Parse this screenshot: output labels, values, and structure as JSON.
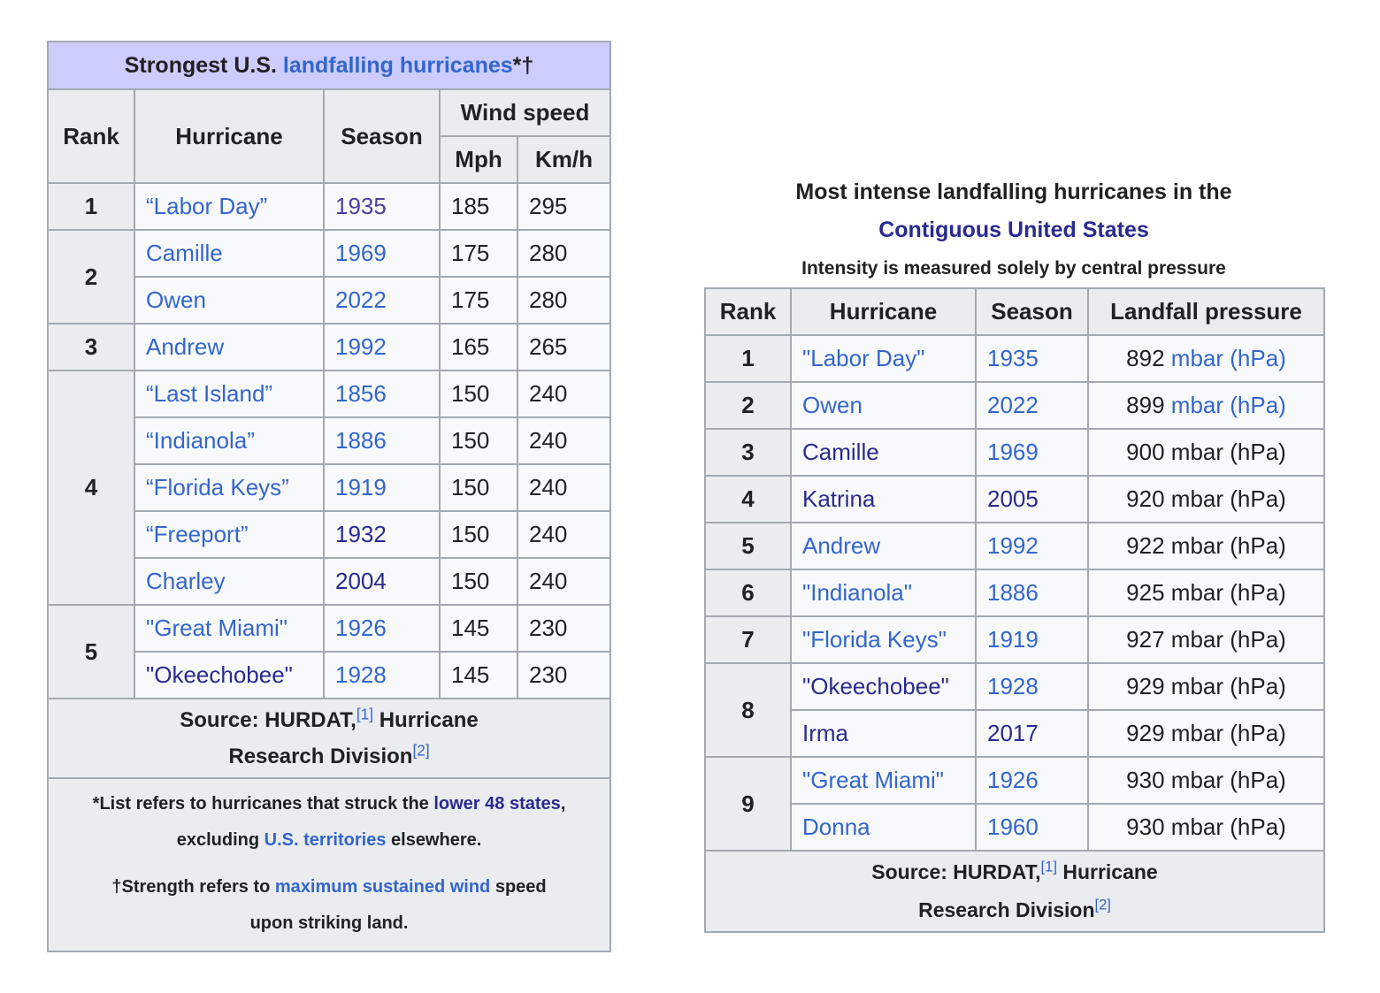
{
  "table1": {
    "caption": {
      "prefix": "Strongest U.S. ",
      "link": "landfalling hurricanes",
      "suffix": "*†"
    },
    "headers": {
      "rank": "Rank",
      "hurricane": "Hurricane",
      "season": "Season",
      "wind_speed": "Wind speed",
      "mph": "Mph",
      "kmh": "Km/h"
    },
    "rows": [
      {
        "rank": "1",
        "name": "“Labor Day”",
        "season": "1935",
        "mph": "185",
        "kmh": "295"
      },
      {
        "rank": "2",
        "name": "Camille",
        "season": "1969",
        "mph": "175",
        "kmh": "280"
      },
      {
        "name": "Owen",
        "season": "2022",
        "mph": "175",
        "kmh": "280"
      },
      {
        "rank": "3",
        "name": "Andrew",
        "season": "1992",
        "mph": "165",
        "kmh": "265"
      },
      {
        "rank": "4",
        "name": "“Last Island”",
        "season": "1856",
        "mph": "150",
        "kmh": "240"
      },
      {
        "name": "“Indianola”",
        "season": "1886",
        "mph": "150",
        "kmh": "240"
      },
      {
        "name": "“Florida Keys”",
        "season": "1919",
        "mph": "150",
        "kmh": "240"
      },
      {
        "name": "“Freeport”",
        "season": "1932",
        "mph": "150",
        "kmh": "240"
      },
      {
        "name": "Charley",
        "season": "2004",
        "mph": "150",
        "kmh": "240"
      },
      {
        "rank": "5",
        "name": "\"Great Miami\"",
        "season": "1926",
        "mph": "145",
        "kmh": "230"
      },
      {
        "name": "\"Okeechobee\"",
        "season": "1928",
        "mph": "145",
        "kmh": "230"
      }
    ],
    "source": {
      "text1": "Source: HURDAT,",
      "ref1": "[1]",
      "text2": " Hurricane",
      "text3": "Research Division",
      "ref2": "[2]"
    },
    "notes": {
      "n1_a": "*List refers to hurricanes that struck the ",
      "n1_link1": "lower 48 states",
      "n1_b": ",",
      "n1_c": "excluding ",
      "n1_link2": "U.S. territories",
      "n1_d": " elsewhere.",
      "n2_a": "†Strength refers to ",
      "n2_link": "maximum sustained wind",
      "n2_b": " speed",
      "n2_c": "upon striking land."
    }
  },
  "table2": {
    "caption_line1": "Most intense landfalling hurricanes in the",
    "caption_link": "Contiguous United States",
    "subtitle": "Intensity is measured solely by central pressure",
    "headers": {
      "rank": "Rank",
      "hurricane": "Hurricane",
      "season": "Season",
      "pressure": "Landfall pressure"
    },
    "rows": [
      {
        "rank": "1",
        "name": "\"Labor Day\"",
        "season": "1935",
        "value": "892",
        "unit": "mbar",
        "unit2": "(hPa)"
      },
      {
        "rank": "2",
        "name": "Owen",
        "season": "2022",
        "value": "899",
        "unit": "mbar",
        "unit2": "(hPa)"
      },
      {
        "rank": "3",
        "name": "Camille",
        "season": "1969",
        "value": "900",
        "unit": "mbar",
        "unit2": "(hPa)"
      },
      {
        "rank": "4",
        "name": "Katrina",
        "season": "2005",
        "value": "920",
        "unit": "mbar",
        "unit2": "(hPa)"
      },
      {
        "rank": "5",
        "name": "Andrew",
        "season": "1992",
        "value": "922",
        "unit": "mbar",
        "unit2": "(hPa)"
      },
      {
        "rank": "6",
        "name": "\"Indianola\"",
        "season": "1886",
        "value": "925",
        "unit": "mbar",
        "unit2": "(hPa)"
      },
      {
        "rank": "7",
        "name": "\"Florida Keys\"",
        "season": "1919",
        "value": "927",
        "unit": "mbar",
        "unit2": "(hPa)"
      },
      {
        "rank": "8",
        "name": "\"Okeechobee\"",
        "season": "1928",
        "value": "929",
        "unit": "mbar",
        "unit2": "(hPa)"
      },
      {
        "name": "Irma",
        "season": "2017",
        "value": "929",
        "unit": "mbar",
        "unit2": "(hPa)"
      },
      {
        "rank": "9",
        "name": "\"Great Miami\"",
        "season": "1926",
        "value": "930",
        "unit": "mbar",
        "unit2": "(hPa)"
      },
      {
        "name": "Donna",
        "season": "1960",
        "value": "930",
        "unit": "mbar",
        "unit2": "(hPa)"
      }
    ],
    "source": {
      "text1": "Source: HURDAT,",
      "ref1": "[1]",
      "text2": " Hurricane",
      "text3": "Research Division",
      "ref2": "[2]"
    }
  }
}
